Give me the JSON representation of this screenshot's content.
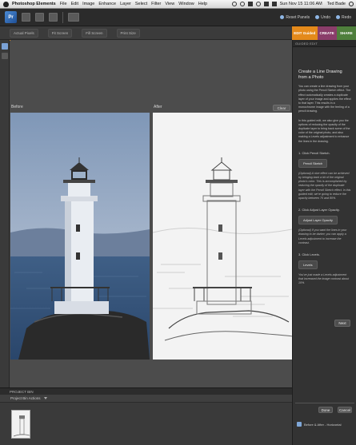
{
  "menubar": {
    "app": "Photoshop Elements",
    "items": [
      "File",
      "Edit",
      "Image",
      "Enhance",
      "Layer",
      "Select",
      "Filter",
      "View",
      "Window",
      "Help"
    ],
    "clock": "Sun Nov 15  11:06 AM",
    "user": "Ted Bade"
  },
  "appbar": {
    "logo_text": "Pr",
    "links": [
      "Reset Panels",
      "Undo",
      "Redo"
    ]
  },
  "viewbar": {
    "options": [
      "Actual Pixels",
      "Fit Screen",
      "Fill Screen",
      "Print Size"
    ]
  },
  "modetabs": {
    "edit": "EDIT Guided",
    "create": "CREATE",
    "share": "SHARE"
  },
  "work": {
    "before_label": "Before",
    "after_label": "After",
    "clear_label": "Clear"
  },
  "bin": {
    "header": "PROJECT BIN",
    "dropdown_label": "Project Bin Actions"
  },
  "panel": {
    "header": "GUIDED EDIT",
    "title": "Create a Line Drawing from a Photo",
    "intro": "You can create a line drawing from your photo using the Pencil Sketch effect. The effect automatically creates a duplicate layer of your image and applies the effect to that layer. This results in a monochrome image with the feeling of a pencil drawing.",
    "intro2": "In this guided edit, we also give you the options of reducing the opacity of the duplicate layer to bring back some of the color of the original photo, and also making a Levels adjustment to enhance the lines in the drawing.",
    "step1": "1. Click Pencil Sketch.",
    "step1_btn": "Pencil Sketch",
    "step1_note": "(Optional) A nice effect can be achieved by bringing back a bit of the original photo's color. This is accomplished by reducing the opacity of the duplicate layer with the Pencil Sketch effect. In this guided edit, we're going to reduce the opacity between 70 and 80%.",
    "step2": "2. Click Adjust Layer Opacity.",
    "step2_btn": "Adjust Layer Opacity",
    "step2_note": "(Optional) If you want the lines in your drawing to be darker, you can apply a Levels adjustment to increase the contrast.",
    "step3": "3. Click Levels.",
    "step3_btn": "Levels",
    "step3_note": "You've just made a Levels adjustment that increased the image contrast about 10%.",
    "next": "Next",
    "done": "Done",
    "cancel": "Cancel",
    "before_after": "Before & After - Horizontal"
  }
}
